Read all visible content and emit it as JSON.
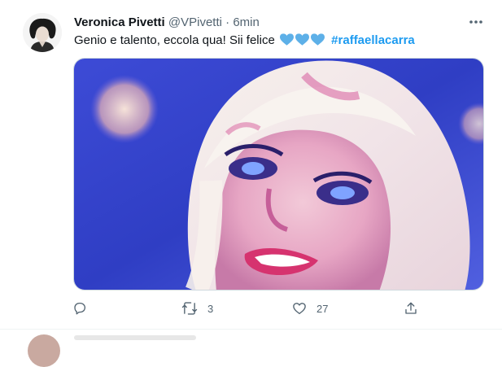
{
  "tweet": {
    "author_name": "Veronica Pivetti",
    "handle": "@VPivetti",
    "separator": "·",
    "time": "6min",
    "text": "Genio e talento, eccola qua! Sii felice",
    "heart_emoji": [
      "blue-heart",
      "blue-heart",
      "blue-heart"
    ],
    "hashtag": "#raffaellacarra",
    "media_description": ""
  },
  "actions": {
    "reply_count": "",
    "retweet_count": "3",
    "like_count": "27"
  },
  "colors": {
    "link": "#1d9bf0",
    "secondary_text": "#536471",
    "heart": "#5db0e8",
    "divider": "#eff3f4"
  },
  "icons": {
    "more": "more-horizontal-icon",
    "reply": "reply-icon",
    "retweet": "retweet-icon",
    "like": "like-icon",
    "share": "share-icon"
  }
}
